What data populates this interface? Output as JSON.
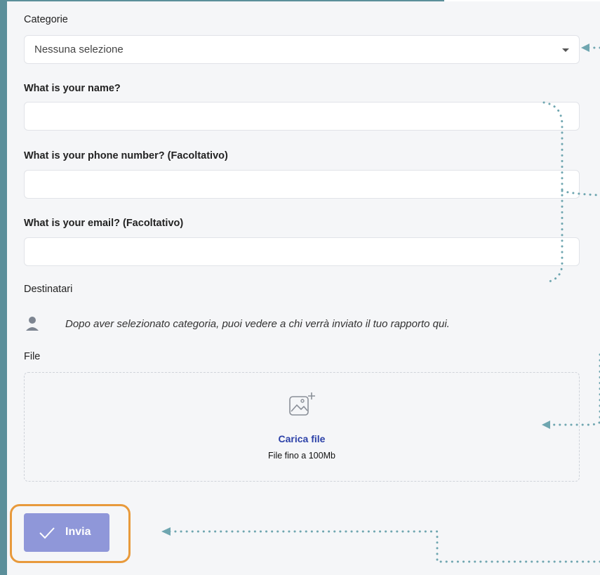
{
  "form": {
    "category_label": "Categorie",
    "category_value": "Nessuna selezione",
    "name_label": "What is your name?",
    "name_value": "",
    "phone_label": "What is your phone number? (Facoltativo)",
    "phone_value": "",
    "email_label": "What is your email? (Facoltativo)",
    "email_value": "",
    "recipients_label": "Destinatari",
    "recipients_hint": "Dopo aver selezionato categoria, puoi vedere a chi verrà inviato il tuo rapporto qui.",
    "file_label": "File",
    "upload_link": "Carica file",
    "upload_hint": "File fino a 100Mb",
    "submit_label": "Invia"
  },
  "icons": {
    "select": "chevron-down-icon",
    "recipient": "user-icon",
    "upload": "image-add-icon",
    "submit": "check-icon"
  },
  "colors": {
    "frame": "#5b8f9a",
    "annotation_arrows": "#6fa6b0",
    "highlight_outline": "#e89a3c",
    "submit_button": "#8f97d9",
    "upload_link": "#2c41a8"
  }
}
